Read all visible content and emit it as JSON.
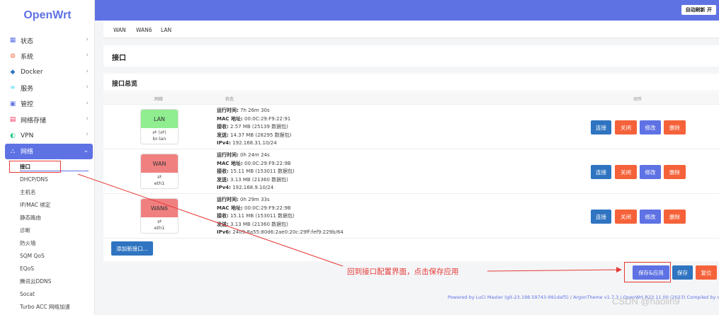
{
  "sidebar": {
    "logo": "OpenWrt",
    "items": [
      {
        "label": "状态",
        "icon": "dashboard-icon",
        "glyph": "▦",
        "color": "#5e72e4"
      },
      {
        "label": "系统",
        "icon": "gear-icon",
        "glyph": "⚙",
        "color": "#f5623a"
      },
      {
        "label": "Docker",
        "icon": "docker-icon",
        "glyph": "◆",
        "color": "#2f74c0"
      },
      {
        "label": "服务",
        "icon": "link-icon",
        "glyph": "∞",
        "color": "#11cdef"
      },
      {
        "label": "管控",
        "icon": "control-icon",
        "glyph": "▣",
        "color": "#5e72e4"
      },
      {
        "label": "网络存储",
        "icon": "storage-icon",
        "glyph": "▤",
        "color": "#f5365c"
      },
      {
        "label": "VPN",
        "icon": "vpn-icon",
        "glyph": "◐",
        "color": "#2dce89"
      },
      {
        "label": "网络",
        "icon": "network-icon",
        "glyph": "⛬",
        "color": "#ffffff"
      }
    ],
    "sub_items": [
      "接口",
      "DHCP/DNS",
      "主机名",
      "IP/MAC 绑定",
      "静态路由",
      "诊断",
      "防火墙",
      "SQM QoS",
      "EQoS",
      "腾讯云DDNS",
      "Socat",
      "Turbo ACC 网络加速"
    ]
  },
  "topbar": {
    "refresh_label": "自动刷新 开"
  },
  "tabs": [
    "WAN",
    "WAN6",
    "LAN"
  ],
  "page_title": "接口",
  "overview": {
    "title": "接口总览",
    "col_network": "网络",
    "col_status": "状态",
    "col_actions": "动作",
    "interfaces": [
      {
        "name": "LAN",
        "color": "#90ee90",
        "device": "br-lan",
        "icons": "⇄ (⇄)",
        "status": [
          {
            "k": "运行时间:",
            "v": " 7h 26m 30s"
          },
          {
            "k": "MAC 地址:",
            "v": " 00:0C:29:F9:22:91"
          },
          {
            "k": "接收:",
            "v": " 2.57 MB (25139 数据包)"
          },
          {
            "k": "发送:",
            "v": " 14.37 MB (28295 数据包)"
          },
          {
            "k": "IPv4:",
            "v": " 192.168.31.10/24"
          }
        ]
      },
      {
        "name": "WAN",
        "color": "#f08080",
        "device": "eth1",
        "icons": "⇄",
        "status": [
          {
            "k": "运行时间:",
            "v": " 0h 24m 24s"
          },
          {
            "k": "MAC 地址:",
            "v": " 00:0C:29:F9:22:9B"
          },
          {
            "k": "接收:",
            "v": " 15.11 MB (153011 数据包)"
          },
          {
            "k": "发送:",
            "v": " 3.13 MB (21360 数据包)"
          },
          {
            "k": "IPv4:",
            "v": " 192.168.9.10/24"
          }
        ]
      },
      {
        "name": "WAN6",
        "color": "#f08080",
        "device": "eth1",
        "icons": "⇄",
        "status": [
          {
            "k": "运行时间:",
            "v": " 0h 29m 33s"
          },
          {
            "k": "MAC 地址:",
            "v": " 00:0C:29:F9:22:9B"
          },
          {
            "k": "接收:",
            "v": " 15.11 MB (153011 数据包)"
          },
          {
            "k": "发送:",
            "v": " 3.13 MB (21360 数据包)"
          },
          {
            "k": "IPv6:",
            "v": " 2409:8a55:80d6:2ae0:20c:29ff:fef9:229b/64"
          }
        ]
      }
    ],
    "buttons": {
      "connect": "连接",
      "close": "关闭",
      "edit": "修改",
      "delete": "删除"
    },
    "add_label": "添加新接口..."
  },
  "actions": {
    "apply": "保存&应用",
    "save": "保存",
    "reset": "复位"
  },
  "annotation": "回到接口配置界面，点击保存应用",
  "footer": "Powered by LuCI Master (git-23.198.59743-991daf5) / ArgonTheme v1.7.3 / OpenWrt R23.11.00 (2023) Compiled by c",
  "watermark": "CSDN @haolin9"
}
